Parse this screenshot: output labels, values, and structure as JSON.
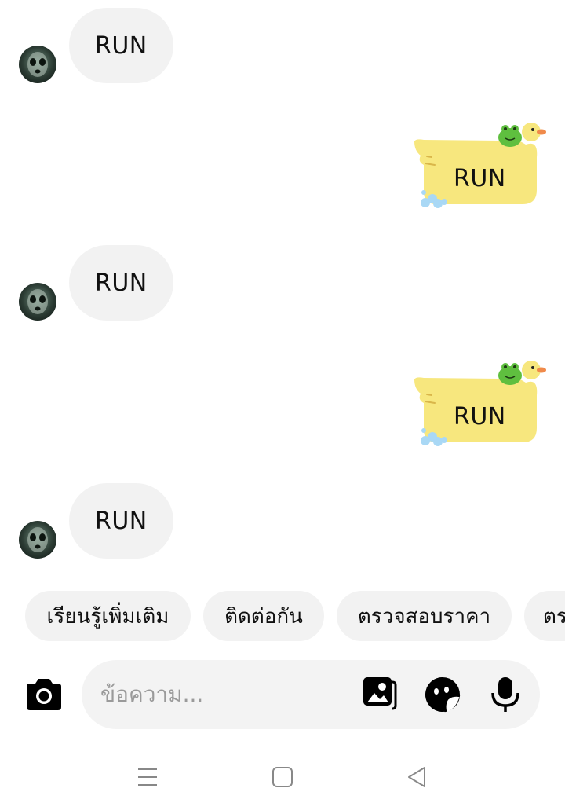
{
  "messages": {
    "incoming_1": "RUN",
    "outgoing_1": "RUN",
    "incoming_2": "RUN",
    "outgoing_2": "RUN",
    "incoming_3": "RUN"
  },
  "quick_replies": [
    "เรียนรู้เพิ่มเติม",
    "ติดต่อกัน",
    "ตรวจสอบราคา",
    "ตร"
  ],
  "composer": {
    "placeholder": "ข้อความ...",
    "icons": [
      "camera-icon",
      "gallery-icon",
      "sticker-icon",
      "microphone-icon"
    ]
  },
  "navigation": {
    "icons": [
      "menu-icon",
      "home-icon",
      "back-icon"
    ]
  },
  "colors": {
    "incoming_bubble": "#f2f2f2",
    "duck_body": "#f7e77e",
    "frog": "#5fbf3f",
    "water": "#a9d8f5",
    "beak": "#f08a4b"
  }
}
